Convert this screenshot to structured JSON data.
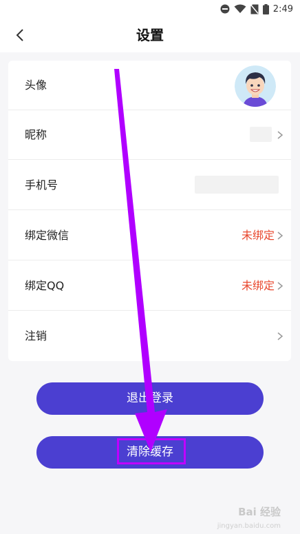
{
  "status_bar": {
    "time": "2:49"
  },
  "header": {
    "title": "设置"
  },
  "settings": {
    "avatar_label": "头像",
    "nickname_label": "昵称",
    "phone_label": "手机号",
    "wechat_label": "绑定微信",
    "wechat_value": "未绑定",
    "qq_label": "绑定QQ",
    "qq_value": "未绑定",
    "cancel_label": "注销"
  },
  "buttons": {
    "logout": "退出登录",
    "clear_cache": "清除缓存"
  },
  "watermark": {
    "text": "Bai 经验",
    "sub": "jingyan.baidu.com"
  },
  "colors": {
    "accent": "#4b3fd1",
    "warning": "#e8462c",
    "annotation": "#b000ff"
  }
}
